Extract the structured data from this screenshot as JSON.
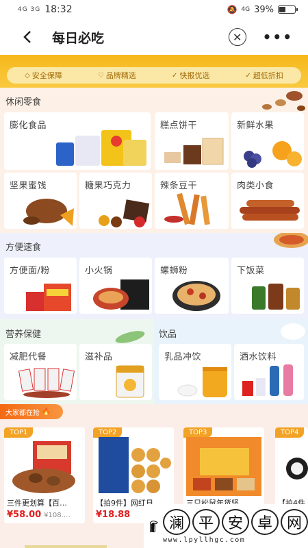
{
  "status": {
    "signal": "4G 3G",
    "time": "18:32",
    "net": "4G",
    "battery": "39%"
  },
  "nav": {
    "title": "每日必吃"
  },
  "guarantees": [
    "安全保障",
    "品牌精选",
    "快报优选",
    "超低折扣"
  ],
  "sections": {
    "snacks": {
      "title": "休闲零食",
      "items": [
        "膨化食品",
        "糕点饼干",
        "新鲜水果",
        "坚果蜜饯",
        "糖果巧克力",
        "辣条豆干",
        "肉类小食"
      ]
    },
    "fast": {
      "title": "方便速食",
      "items": [
        "方便面/粉",
        "小火锅",
        "螺蛳粉",
        "下饭菜"
      ]
    },
    "health": {
      "title": "营养保健",
      "items": [
        "减肥代餐",
        "滋补品"
      ]
    },
    "drinks": {
      "title": "饮品",
      "items": [
        "乳品冲饮",
        "酒水饮料"
      ]
    }
  },
  "hot": {
    "label": "大家都在抢"
  },
  "products": [
    {
      "badge": "TOP1",
      "name": "三件更划算【百…",
      "price": "¥58.00",
      "old": "¥108.…"
    },
    {
      "badge": "TOP2",
      "name": "【拍9件】网红日…",
      "price": "¥18.88",
      "old": ""
    },
    {
      "badge": "TOP3",
      "name": "三只松鼠年货坚…",
      "price": "",
      "old": ""
    },
    {
      "badge": "TOP4",
      "name": "【拍4件",
      "price": "",
      "old": ""
    }
  ],
  "watermark": {
    "chars": [
      "澜",
      "平",
      "安",
      "卓",
      "网"
    ],
    "url": "www.lpyllhgc.com"
  },
  "colors": {
    "accent": "#f6b81b",
    "price": "#e02020",
    "hot": "#f46a13"
  }
}
